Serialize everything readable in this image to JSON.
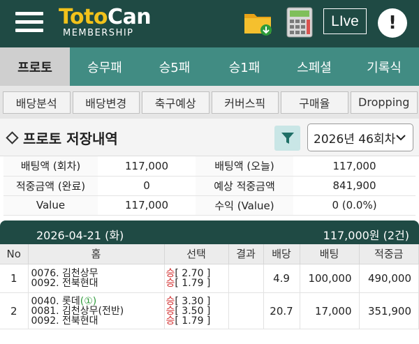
{
  "header": {
    "logo_part1": "Toto",
    "logo_part2": "Can",
    "logo_sub": "MEMBERSHIP",
    "live_label": "LIve",
    "info_label": "!"
  },
  "main_nav": [
    "프로토",
    "승무패",
    "승5패",
    "승1패",
    "스페셜",
    "기록식"
  ],
  "sub_nav": [
    "배당분석",
    "배당변경",
    "축구예상",
    "커버스픽",
    "구매율",
    "Dropping"
  ],
  "section": {
    "title": "프로토 저장내역",
    "round_select": "2026년 46회차"
  },
  "summary": [
    {
      "l1": "배팅액 (회차)",
      "v1": "117,000",
      "l2": "배팅액 (오늘)",
      "v2": "117,000"
    },
    {
      "l1": "적중금액 (완료)",
      "v1": "0",
      "l2": "예상 적중금액",
      "v2": "841,900"
    },
    {
      "l1": "Value",
      "v1": "117,000",
      "l2": "수익 (Value)",
      "v2": "0 (0.0%)"
    }
  ],
  "date_bar": {
    "date": "2026-04-21 (화)",
    "amount": "117,000원 (2건)"
  },
  "table": {
    "headers": [
      "No",
      "홈",
      "선택",
      "결과",
      "배당",
      "배팅",
      "적중금"
    ],
    "rows": [
      {
        "no": "1",
        "games": [
          "0076. 김천상무",
          "0092. 전북현대"
        ],
        "picks": [
          {
            "pick": "승",
            "odds": "[ 2.70 ]"
          },
          {
            "pick": "승",
            "odds": "[ 1.79 ]"
          }
        ],
        "result": "",
        "odds": "4.9",
        "bet": "100,000",
        "payout": "490,000"
      },
      {
        "no": "2",
        "games": [
          "0040. 롯데",
          "0081. 김천상무(전반)",
          "0092. 전북현대"
        ],
        "game_mark": "(①)",
        "picks": [
          {
            "pick": "승",
            "odds": "[ 3.30 ]"
          },
          {
            "pick": "승",
            "odds": "[ 3.50 ]"
          },
          {
            "pick": "승",
            "odds": "[ 1.79 ]"
          }
        ],
        "result": "",
        "odds": "20.7",
        "bet": "17,000",
        "payout": "351,900"
      }
    ]
  },
  "colors": {
    "header_bg": "#1f4a44",
    "nav_bg": "#418c83",
    "logo_yellow": "#f2c21b",
    "pick_red": "#d32f2f"
  }
}
